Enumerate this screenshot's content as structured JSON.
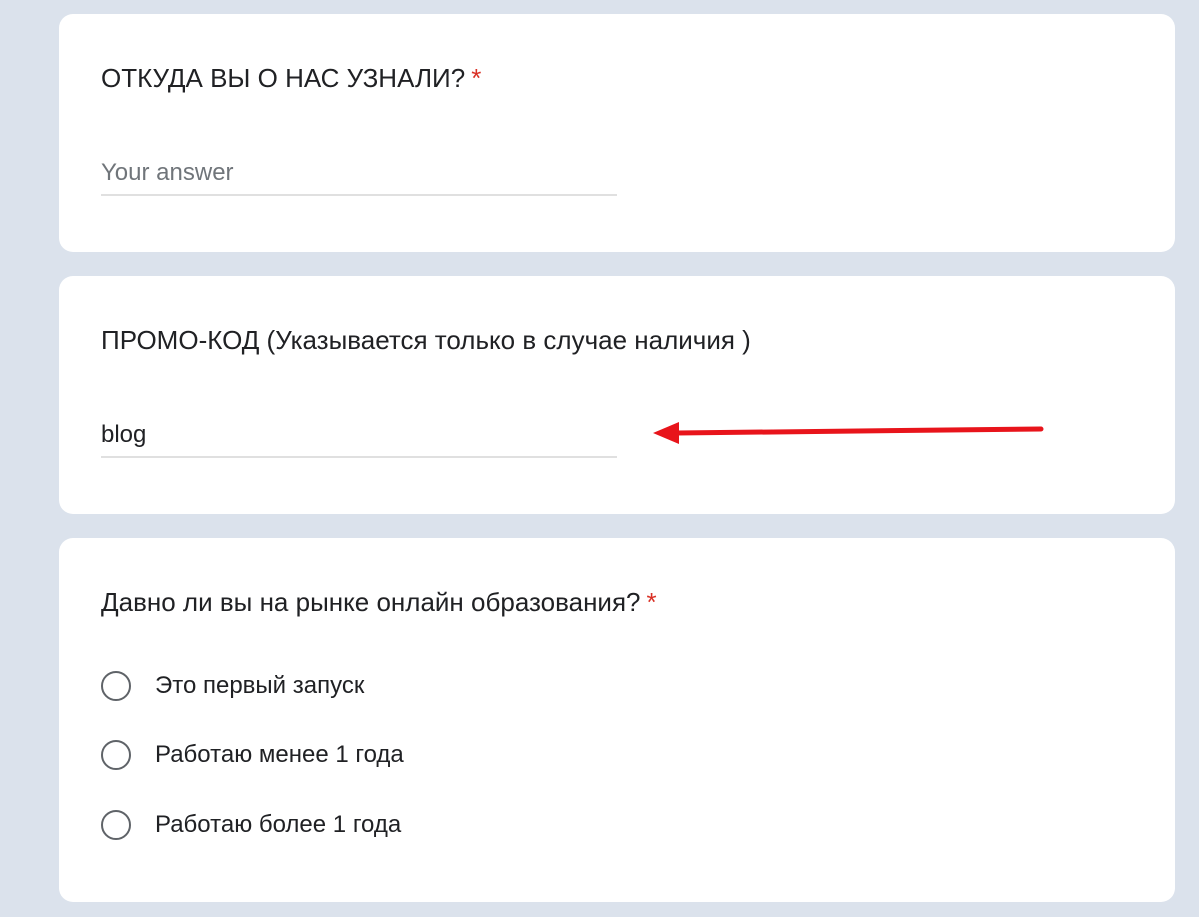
{
  "questions": {
    "source": {
      "title": "ОТКУДА ВЫ О НАС УЗНАЛИ?",
      "required_mark": "*",
      "placeholder": "Your answer",
      "value": ""
    },
    "promo": {
      "title": "ПРОМО-КОД (Указывается только в случае наличия )",
      "value": "blog"
    },
    "market": {
      "title": "Давно ли вы на рынке онлайн образования?",
      "required_mark": "*",
      "options": [
        {
          "label": "Это первый запуск"
        },
        {
          "label": "Работаю менее 1 года"
        },
        {
          "label": "Работаю более 1 года"
        }
      ]
    }
  },
  "colors": {
    "background": "#dbe2ec",
    "card": "#ffffff",
    "required": "#d93025",
    "annotation_arrow": "#e8141b",
    "radio_border": "#5f6368"
  },
  "icons": {
    "annotation": "left-arrow-icon",
    "radio": "radio-unchecked-icon"
  }
}
